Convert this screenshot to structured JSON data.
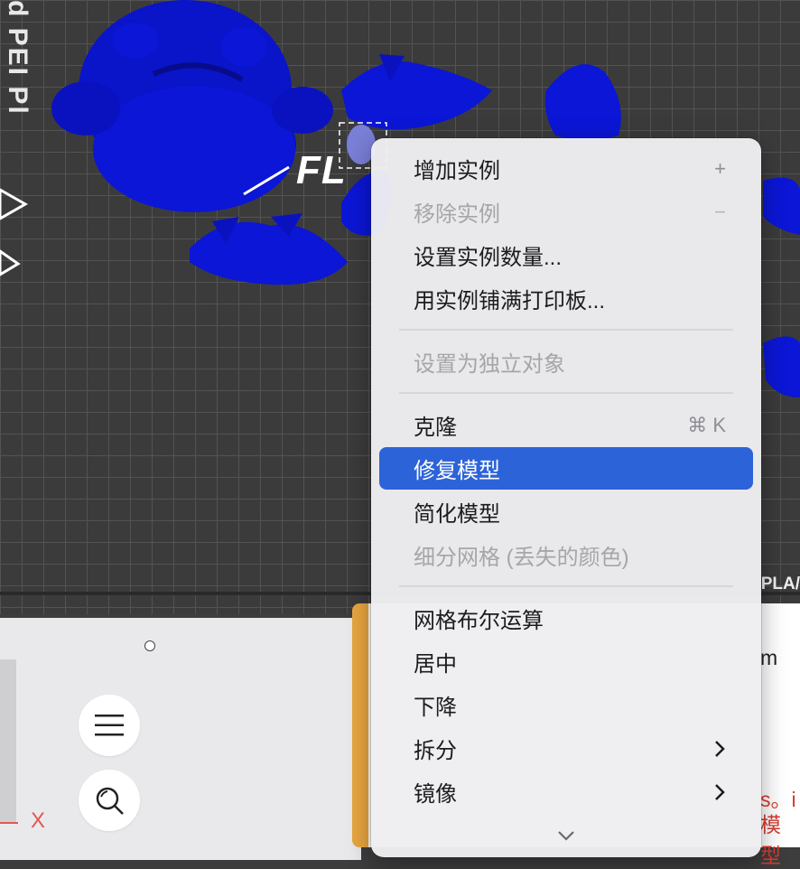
{
  "viewport": {
    "plate_label_left": "d PEI Pl",
    "plate_brand": "FL",
    "plate_material": "PLA/"
  },
  "context_menu": {
    "items": [
      {
        "label": "增加实例",
        "shortcut": "+",
        "disabled": false
      },
      {
        "label": "移除实例",
        "shortcut": "−",
        "disabled": true
      },
      {
        "label": "设置实例数量...",
        "shortcut": "",
        "disabled": false
      },
      {
        "label": "用实例铺满打印板...",
        "shortcut": "",
        "disabled": false
      },
      {
        "label": "设置为独立对象",
        "shortcut": "",
        "disabled": true
      },
      {
        "label": "克隆",
        "shortcut": "⌘ K",
        "disabled": false
      },
      {
        "label": "修复模型",
        "shortcut": "",
        "disabled": false,
        "highlighted": true
      },
      {
        "label": "简化模型",
        "shortcut": "",
        "disabled": false
      },
      {
        "label": "细分网格 (丢失的颜色)",
        "shortcut": "",
        "disabled": true
      },
      {
        "label": "网格布尔运算",
        "shortcut": "",
        "disabled": false
      },
      {
        "label": "居中",
        "shortcut": "",
        "disabled": false
      },
      {
        "label": "下降",
        "shortcut": "",
        "disabled": false
      },
      {
        "label": "拆分",
        "shortcut": "",
        "disabled": false,
        "submenu": true
      },
      {
        "label": "镜像",
        "shortcut": "",
        "disabled": false,
        "submenu": true
      }
    ],
    "scroll_icon": "chevron-down-icon"
  },
  "side_panel": {
    "menu_icon": "hamburger-menu-icon",
    "search_icon": "search-icon",
    "axis_label": "X"
  },
  "notice": {
    "unit_text": "m",
    "warn_line_1": "s。i",
    "warn_line_2": "模型"
  },
  "colors": {
    "highlight": "#2d63d8",
    "model_blue": "#0a14c8",
    "notice_accent": "#e8a640",
    "warning_red": "#d93a2f"
  }
}
